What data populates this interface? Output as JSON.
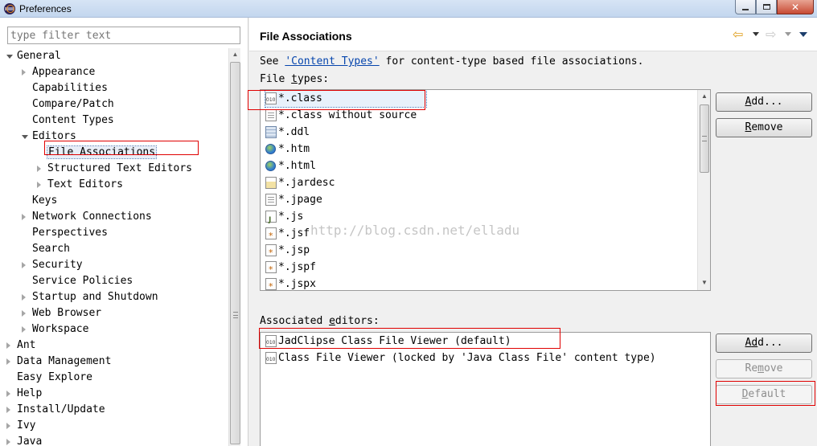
{
  "window": {
    "title": "Preferences"
  },
  "filter": {
    "placeholder": "type filter text"
  },
  "tree": [
    {
      "label": "General",
      "level": 0,
      "state": "open"
    },
    {
      "label": "Appearance",
      "level": 1,
      "state": "closed"
    },
    {
      "label": "Capabilities",
      "level": 1,
      "state": "none"
    },
    {
      "label": "Compare/Patch",
      "level": 1,
      "state": "none"
    },
    {
      "label": "Content Types",
      "level": 1,
      "state": "none"
    },
    {
      "label": "Editors",
      "level": 1,
      "state": "open"
    },
    {
      "label": "File Associations",
      "level": 2,
      "state": "none",
      "selected": true
    },
    {
      "label": "Structured Text Editors",
      "level": 2,
      "state": "closed"
    },
    {
      "label": "Text Editors",
      "level": 2,
      "state": "closed"
    },
    {
      "label": "Keys",
      "level": 1,
      "state": "none"
    },
    {
      "label": "Network Connections",
      "level": 1,
      "state": "closed"
    },
    {
      "label": "Perspectives",
      "level": 1,
      "state": "none"
    },
    {
      "label": "Search",
      "level": 1,
      "state": "none"
    },
    {
      "label": "Security",
      "level": 1,
      "state": "closed"
    },
    {
      "label": "Service Policies",
      "level": 1,
      "state": "none"
    },
    {
      "label": "Startup and Shutdown",
      "level": 1,
      "state": "closed"
    },
    {
      "label": "Web Browser",
      "level": 1,
      "state": "closed"
    },
    {
      "label": "Workspace",
      "level": 1,
      "state": "closed"
    },
    {
      "label": "Ant",
      "level": 0,
      "state": "closed"
    },
    {
      "label": "Data Management",
      "level": 0,
      "state": "closed"
    },
    {
      "label": "Easy Explore",
      "level": 0,
      "state": "none"
    },
    {
      "label": "Help",
      "level": 0,
      "state": "closed"
    },
    {
      "label": "Install/Update",
      "level": 0,
      "state": "closed"
    },
    {
      "label": "Ivy",
      "level": 0,
      "state": "closed"
    },
    {
      "label": "Java",
      "level": 0,
      "state": "closed"
    }
  ],
  "page": {
    "title": "File Associations",
    "see_prefix": "See ",
    "see_link": "'Content Types'",
    "see_suffix": " for content-type based file associations.",
    "file_types_label_a": "File ",
    "file_types_label_u": "t",
    "file_types_label_b": "ypes:",
    "assoc_label_a": "Associated ",
    "assoc_label_u": "e",
    "assoc_label_b": "ditors:"
  },
  "file_types": [
    {
      "label": "*.class",
      "icon": "bin",
      "selected": true
    },
    {
      "label": "*.class without source",
      "icon": "doc"
    },
    {
      "label": "*.ddl",
      "icon": "ddl"
    },
    {
      "label": "*.htm",
      "icon": "globe"
    },
    {
      "label": "*.html",
      "icon": "globe"
    },
    {
      "label": "*.jardesc",
      "icon": "jar"
    },
    {
      "label": "*.jpage",
      "icon": "doc"
    },
    {
      "label": "*.js",
      "icon": "js"
    },
    {
      "label": "*.jsf",
      "icon": "jsp"
    },
    {
      "label": "*.jsp",
      "icon": "jsp"
    },
    {
      "label": "*.jspf",
      "icon": "jsp"
    },
    {
      "label": "*.jspx",
      "icon": "jsp"
    }
  ],
  "editors": [
    {
      "label": "JadClipse Class File Viewer (default)",
      "icon": "bin"
    },
    {
      "label": "Class File Viewer (locked by 'Java Class File' content type)",
      "icon": "bin"
    }
  ],
  "buttons": {
    "add_u": "A",
    "add_rest": "dd...",
    "remove_u": "R",
    "remove_rest": "emove",
    "add2_u": "A",
    "add2_mid": "d",
    "add2_rest": "d...",
    "remove2_a": "Re",
    "remove2_u": "m",
    "remove2_b": "ove",
    "default_u": "D",
    "default_rest": "efault"
  },
  "watermark": "http://blog.csdn.net/elladu"
}
